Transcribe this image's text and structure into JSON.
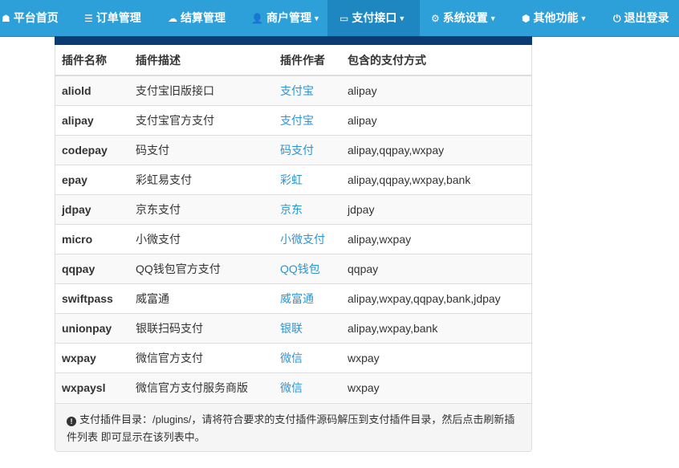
{
  "nav": {
    "items": [
      {
        "icon": "home-icon",
        "glyph": "☗",
        "label": "平台首页",
        "caret": ""
      },
      {
        "icon": "list-icon",
        "glyph": "☰",
        "label": "订单管理",
        "caret": ""
      },
      {
        "icon": "cloud-icon",
        "glyph": "☁",
        "label": "结算管理",
        "caret": ""
      },
      {
        "icon": "user-icon",
        "glyph": "👤",
        "label": "商户管理",
        "caret": "▼"
      },
      {
        "icon": "card-icon",
        "glyph": "▭",
        "label": "支付接口",
        "caret": "▼"
      },
      {
        "icon": "gear-icon",
        "glyph": "⚙",
        "label": "系统设置",
        "caret": "▼"
      },
      {
        "icon": "cube-icon",
        "glyph": "⬢",
        "label": "其他功能",
        "caret": "▼"
      },
      {
        "icon": "power-icon",
        "glyph": "⏻",
        "label": "退出登录",
        "caret": ""
      }
    ]
  },
  "table": {
    "headers": [
      "插件名称",
      "插件描述",
      "插件作者",
      "包含的支付方式"
    ],
    "rows": [
      {
        "name": "aliold",
        "desc": "支付宝旧版接口",
        "author": "支付宝",
        "methods": "alipay"
      },
      {
        "name": "alipay",
        "desc": "支付宝官方支付",
        "author": "支付宝",
        "methods": "alipay"
      },
      {
        "name": "codepay",
        "desc": "码支付",
        "author": "码支付",
        "methods": "alipay,qqpay,wxpay"
      },
      {
        "name": "epay",
        "desc": "彩虹易支付",
        "author": "彩虹",
        "methods": "alipay,qqpay,wxpay,bank"
      },
      {
        "name": "jdpay",
        "desc": "京东支付",
        "author": "京东",
        "methods": "jdpay"
      },
      {
        "name": "micro",
        "desc": "小微支付",
        "author": "小微支付",
        "methods": "alipay,wxpay"
      },
      {
        "name": "qqpay",
        "desc": "QQ钱包官方支付",
        "author": "QQ钱包",
        "methods": "qqpay"
      },
      {
        "name": "swiftpass",
        "desc": "威富通",
        "author": "威富通",
        "methods": "alipay,wxpay,qqpay,bank,jdpay"
      },
      {
        "name": "unionpay",
        "desc": "银联扫码支付",
        "author": "银联",
        "methods": "alipay,wxpay,bank"
      },
      {
        "name": "wxpay",
        "desc": "微信官方支付",
        "author": "微信",
        "methods": "wxpay"
      },
      {
        "name": "wxpaysl",
        "desc": "微信官方支付服务商版",
        "author": "微信",
        "methods": "wxpay"
      }
    ]
  },
  "footer": {
    "icon": "info-icon",
    "text": "支付插件目录：/plugins/，请将符合要求的支付插件源码解压到支付插件目录，然后点击刷新插件列表 即可显示在该列表中。"
  },
  "colors": {
    "navbar": "#2d9fd9",
    "nav_active": "#1e87c2",
    "panel_heading": "#0a3b73",
    "link": "#2b95d4"
  }
}
